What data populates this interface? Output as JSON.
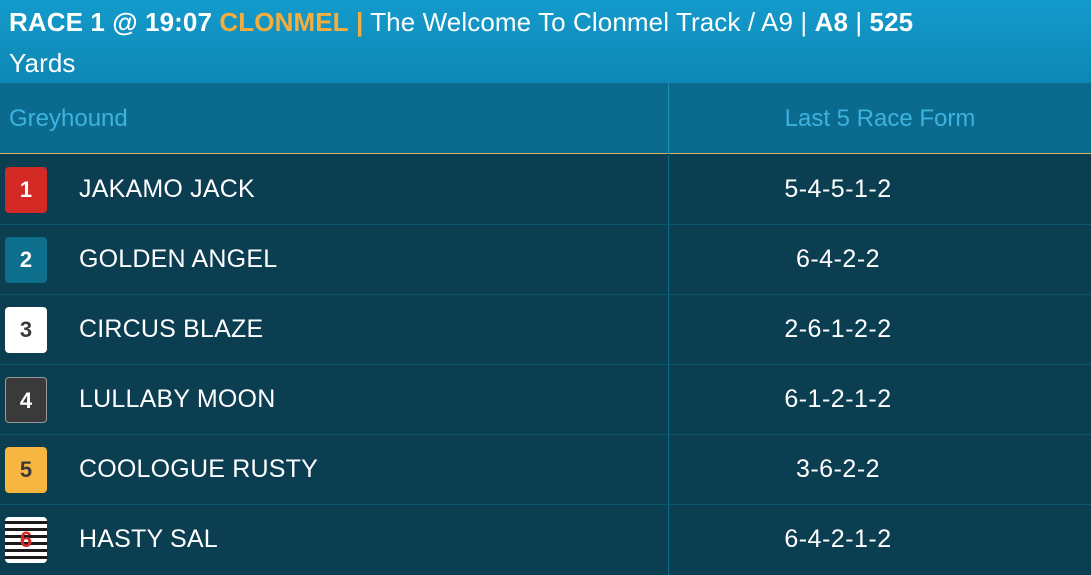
{
  "header": {
    "race": "RACE 1 @ 19:07",
    "venue": "CLONMEL",
    "sep1": "|",
    "title": "The Welcome To Clonmel Track / A9",
    "sep2": "|",
    "grade": "A8",
    "sep3": "|",
    "distance": "525",
    "unit": "Yards"
  },
  "table": {
    "col_greyhound": "Greyhound",
    "col_form": "Last 5 Race Form",
    "rows": [
      {
        "trap": "1",
        "name": "JAKAMO JACK",
        "form": "5-4-5-1-2"
      },
      {
        "trap": "2",
        "name": "GOLDEN ANGEL",
        "form": "6-4-2-2"
      },
      {
        "trap": "3",
        "name": "CIRCUS BLAZE",
        "form": "2-6-1-2-2"
      },
      {
        "trap": "4",
        "name": "LULLABY MOON",
        "form": "6-1-2-1-2"
      },
      {
        "trap": "5",
        "name": "COOLOGUE RUSTY",
        "form": "3-6-2-2"
      },
      {
        "trap": "6",
        "name": "HASTY SAL",
        "form": "6-4-2-1-2"
      }
    ]
  },
  "colors": {
    "header_bg": "#139bcc",
    "venue": "#f5ad3d",
    "table_bg": "#0c3e52",
    "trap1": "#d42a25",
    "trap2": "#0e6f8c",
    "trap3": "#ffffff",
    "trap4": "#3a3a3a",
    "trap5": "#f6b640",
    "trap6": "#ffffff"
  }
}
